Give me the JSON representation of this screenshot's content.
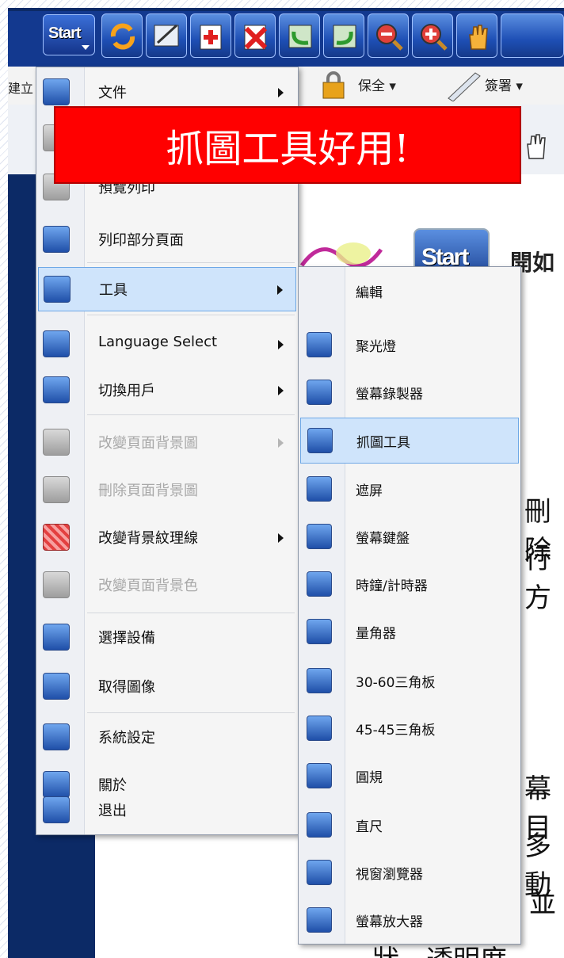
{
  "toolbar": {
    "start_label": "Start",
    "partial_left_text": "建立",
    "security_label": "保全 ▾",
    "sign_label": "簽署 ▾"
  },
  "banner": {
    "text": "抓圖工具好用!"
  },
  "document": {
    "title_partial": "開如",
    "start_logo": "Start",
    "fragments": [
      "刪除",
      "行方",
      "幕目",
      "多動",
      "並",
      "狀、透明度、"
    ]
  },
  "main_menu": {
    "items": [
      {
        "label": "文件",
        "icon": "document-icon",
        "submenu": true,
        "disabled": false
      },
      {
        "label": "",
        "icon": "print-icon",
        "submenu": false,
        "disabled": false
      },
      {
        "label": "預覽列印",
        "icon": "print-preview-icon",
        "submenu": false,
        "disabled": false
      },
      {
        "label": "列印部分頁面",
        "icon": "print-partial-icon",
        "submenu": false,
        "disabled": false
      },
      {
        "label": "工具",
        "icon": "tools-icon",
        "submenu": true,
        "disabled": false,
        "highlighted": true
      },
      {
        "label": "Language Select",
        "icon": "language-icon",
        "submenu": true,
        "disabled": false
      },
      {
        "label": "切換用戶",
        "icon": "switch-user-icon",
        "submenu": true,
        "disabled": false
      },
      {
        "label": "改變頁面背景圖",
        "icon": "page-background-icon",
        "submenu": true,
        "disabled": true
      },
      {
        "label": "刪除頁面背景圖",
        "icon": "delete-background-icon",
        "submenu": false,
        "disabled": true
      },
      {
        "label": "改變背景紋理線",
        "icon": "background-pattern-icon",
        "submenu": true,
        "disabled": false
      },
      {
        "label": "改變頁面背景色",
        "icon": "background-color-icon",
        "submenu": false,
        "disabled": true
      },
      {
        "label": "選擇設備",
        "icon": "select-device-icon",
        "submenu": false,
        "disabled": false
      },
      {
        "label": "取得圖像",
        "icon": "acquire-image-icon",
        "submenu": false,
        "disabled": false
      },
      {
        "label": "系統設定",
        "icon": "system-settings-icon",
        "submenu": false,
        "disabled": false
      },
      {
        "label": "關於",
        "icon": "about-icon",
        "submenu": false,
        "disabled": false
      },
      {
        "label": "退出",
        "icon": "exit-icon",
        "submenu": false,
        "disabled": false
      }
    ]
  },
  "tools_submenu": {
    "items": [
      {
        "label": "編輯",
        "icon": ""
      },
      {
        "label": "聚光燈",
        "icon": "spotlight-icon"
      },
      {
        "label": "螢幕錄製器",
        "icon": "screen-recorder-icon"
      },
      {
        "label": "抓圖工具",
        "icon": "snipping-tool-icon",
        "highlighted": true
      },
      {
        "label": "遮屏",
        "icon": "screen-shade-icon"
      },
      {
        "label": "螢幕鍵盤",
        "icon": "on-screen-keyboard-icon"
      },
      {
        "label": "時鐘/計時器",
        "icon": "clock-timer-icon"
      },
      {
        "label": "量角器",
        "icon": "protractor-icon"
      },
      {
        "label": "30-60三角板",
        "icon": "triangle-30-60-icon"
      },
      {
        "label": "45-45三角板",
        "icon": "triangle-45-45-icon"
      },
      {
        "label": "圓規",
        "icon": "compass-icon"
      },
      {
        "label": "直尺",
        "icon": "ruler-icon"
      },
      {
        "label": "視窗瀏覽器",
        "icon": "window-browser-icon"
      },
      {
        "label": "螢幕放大器",
        "icon": "screen-magnifier-icon"
      }
    ]
  }
}
